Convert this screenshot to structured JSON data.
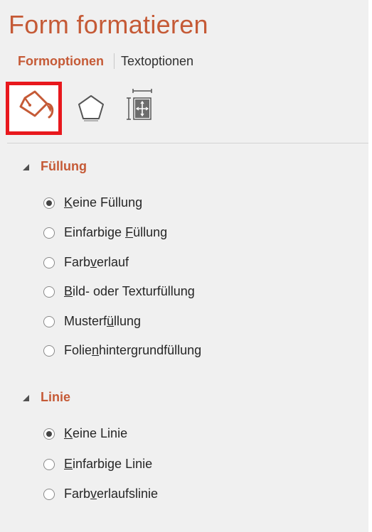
{
  "title": "Form formatieren",
  "tabs": [
    {
      "label": "Formoptionen",
      "active": true
    },
    {
      "label": "Textoptionen",
      "active": false
    }
  ],
  "toolbar": {
    "icons": [
      {
        "name": "fill-line-icon",
        "selected": true
      },
      {
        "name": "effects-pentagon-icon",
        "selected": false
      },
      {
        "name": "size-properties-icon",
        "selected": false
      }
    ]
  },
  "colors": {
    "accent": "#c55a36",
    "highlight": "#e8181d",
    "pane": "#f0f0f0"
  },
  "fill": {
    "title": "Füllung",
    "options": [
      {
        "pre": "",
        "ul": "K",
        "post": "eine Füllung",
        "checked": true
      },
      {
        "pre": "Einfarbige ",
        "ul": "F",
        "post": "üllung",
        "checked": false
      },
      {
        "pre": "Farb",
        "ul": "v",
        "post": "erlauf",
        "checked": false
      },
      {
        "pre": "",
        "ul": "B",
        "post": "ild- oder Texturfüllung",
        "checked": false
      },
      {
        "pre": "Musterf",
        "ul": "ü",
        "post": "llung",
        "checked": false
      },
      {
        "pre": "Folie",
        "ul": "n",
        "post": "hintergrundfüllung",
        "checked": false
      }
    ]
  },
  "line": {
    "title": "Linie",
    "options": [
      {
        "pre": "",
        "ul": "K",
        "post": "eine Linie",
        "checked": true
      },
      {
        "pre": "",
        "ul": "E",
        "post": "infarbige Linie",
        "checked": false
      },
      {
        "pre": "Farb",
        "ul": "v",
        "post": "erlaufslinie",
        "checked": false
      }
    ]
  }
}
